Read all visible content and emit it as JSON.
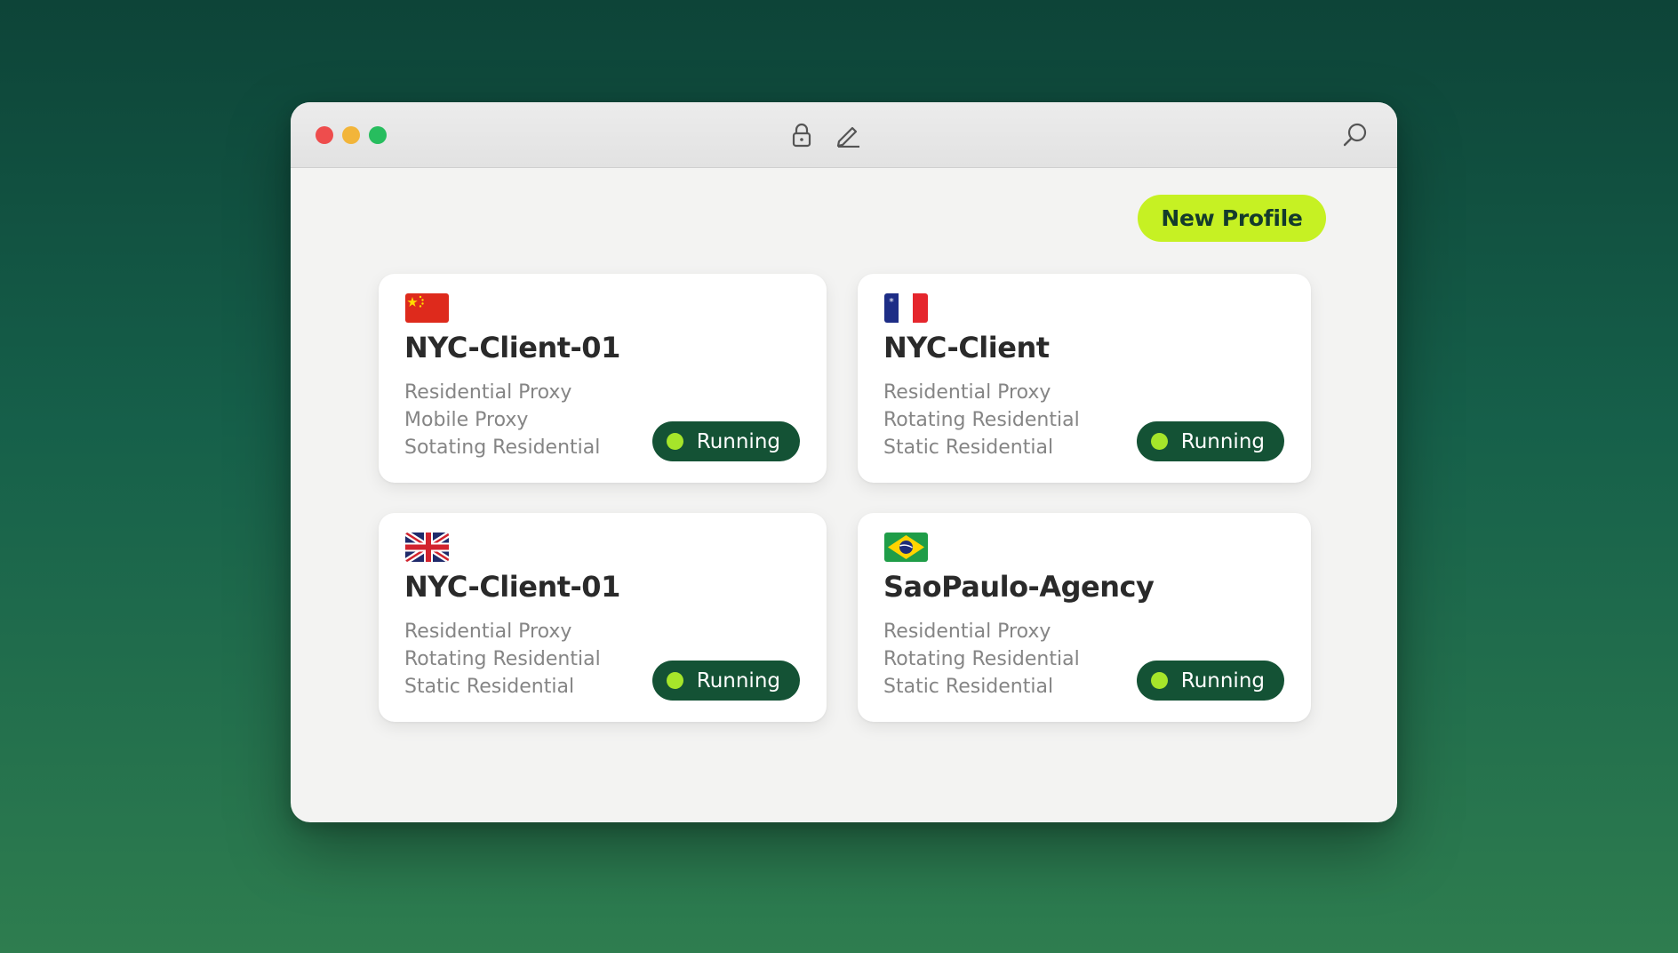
{
  "window": {
    "toolbar": {
      "icons": [
        "lock-icon",
        "pen-icon",
        "search-icon"
      ]
    },
    "new_profile_label": "New Profile"
  },
  "colors": {
    "accent": "#c6f123",
    "status_bg": "#145235",
    "status_dot": "#a6e52a"
  },
  "profiles": [
    {
      "flag": "china-flag-icon",
      "name": "NYC-Client-01",
      "proxies": [
        "Residential Proxy",
        "Mobile Proxy",
        "Sotating Residential"
      ],
      "status": "Running"
    },
    {
      "flag": "france-flag-icon",
      "name": "NYC-Client",
      "proxies": [
        "Residential Proxy",
        "Rotating Residential",
        "Static Residential"
      ],
      "status": "Running"
    },
    {
      "flag": "uk-flag-icon",
      "name": "NYC-Client-01",
      "proxies": [
        "Residential Proxy",
        "Rotating Residential",
        "Static Residential"
      ],
      "status": "Running"
    },
    {
      "flag": "brazil-flag-icon",
      "name": "SaoPaulo-Agency",
      "proxies": [
        "Residential Proxy",
        "Rotating Residential",
        "Static Residential"
      ],
      "status": "Running"
    }
  ]
}
